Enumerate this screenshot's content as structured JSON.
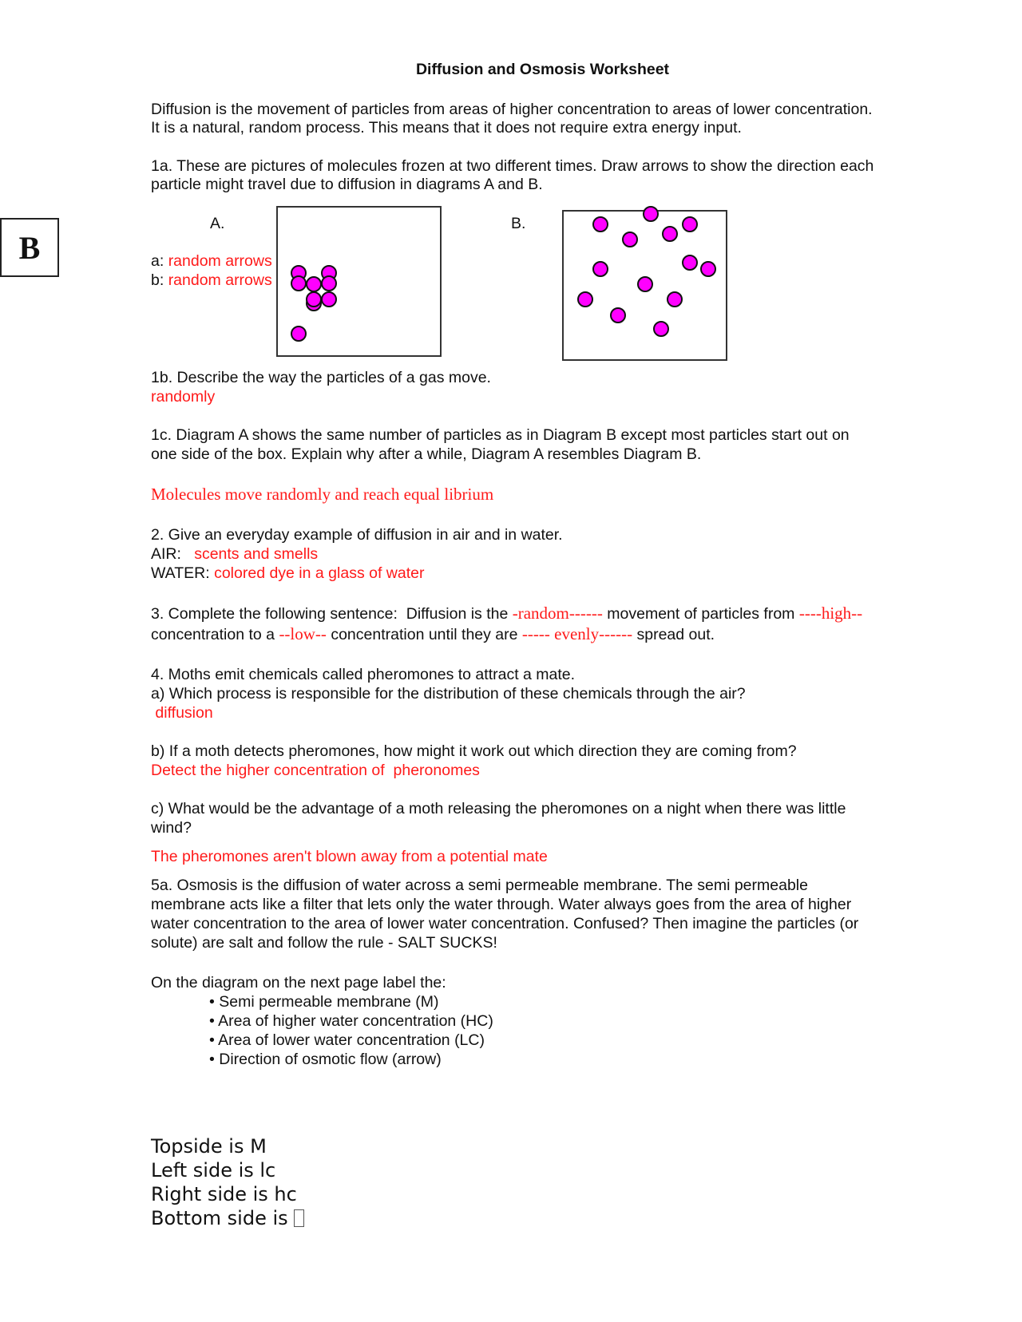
{
  "document": {
    "title": "Diffusion and Osmosis Worksheet",
    "badge": "B",
    "intro": [
      " Diffusion is the movement of particles from areas of higher concentration to areas of lower concentration.",
      "It is a natural, random process. This means that it does not require extra energy input."
    ],
    "q1a": {
      "lines": [
        "1a. These are pictures of molecules frozen at two different times.  Draw arrows to show the direction each",
        "particle might travel due to diffusion in diagrams A and B."
      ],
      "diagram_a_label": "A.",
      "diagram_b_label": "B.",
      "answer_a_prefix": "a: ",
      "answer_a": "random arrows",
      "answer_b_prefix": "b: ",
      "answer_b": "random arrows",
      "particle_color": "#ff00ff",
      "diagram_a_particle_count": 11,
      "diagram_b_particle_count": 14
    },
    "q1b": {
      "question": "1b. Describe the way the particles of a gas move.",
      "answer": "randomly"
    },
    "q1c": {
      "lines": [
        "1c. Diagram A shows the same number of particles as in Diagram B except most particles start out on",
        "one side of the box. Explain why after a while, Diagram A resembles Diagram B."
      ],
      "answer": "Molecules move randomly and  reach equal librium"
    },
    "q2": {
      "question": "2.  Give an everyday example of diffusion in air and in water.",
      "air_label": "AIR:   ",
      "air_answer": "scents and smells",
      "water_label": "WATER: ",
      "water_answer": "colored dye in a glass of water"
    },
    "q3": {
      "part1": "3. Complete the following sentence:  Diffusion is the ",
      "blank1": "-random------",
      "part2": " movement of particles from ",
      "blank2": "----high--",
      "part3": "concentration to a ",
      "blank3": "--low--",
      "part4": " concentration until they are ",
      "blank4": "----- evenly------",
      "part5": " spread out."
    },
    "q4": {
      "intro": "4. Moths emit chemicals called pheromones to attract a mate.",
      "a_question": "a) Which process is responsible for the distribution of these chemicals through the air?",
      "a_answer": " diffusion",
      "b_question": "b) If a moth detects pheromones, how might it work out which direction they are coming from?",
      "b_answer": "Detect the higher concentration of  pheronomes",
      "c_question_lines": [
        "c) What would be the advantage of a moth releasing the pheromones on a night when there was little",
        "wind?"
      ],
      "c_answer": "The pheromones aren't blown away from a potential mate"
    },
    "q5a": {
      "lines": [
        "5a. Osmosis is the diffusion of water across a semi permeable membrane. The semi permeable",
        "membrane acts like a filter that lets only the water through. Water always goes from the area of higher",
        "water concentration to the area of lower water concentration. Confused? Then imagine the particles (or",
        "solute) are salt and follow the rule - SALT SUCKS!"
      ],
      "label_intro": "On the diagram on the next page label the:",
      "bullets": [
        "• Semi permeable membrane (M)",
        "• Area of higher water concentration (HC)",
        "• Area of lower water concentration (LC)",
        "• Direction of osmotic flow (arrow)"
      ]
    },
    "handwritten_answers": [
      "Topside is M",
      "Left side is lc",
      "Right side is hc",
      "Bottom side is "
    ]
  }
}
